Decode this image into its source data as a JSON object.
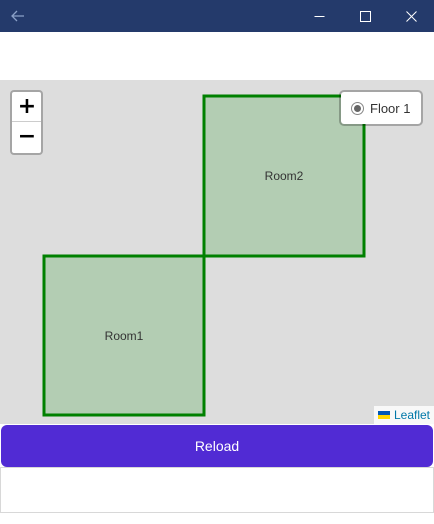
{
  "titlebar": {
    "back_icon": "arrow-left-icon",
    "minimize_icon": "minimize-icon",
    "maximize_icon": "maximize-icon",
    "close_icon": "close-icon",
    "background": "#243a6b"
  },
  "map": {
    "background": "#dddddd",
    "zoom_in_label": "+",
    "zoom_out_label": "−",
    "layer_control": {
      "selected": "Floor 1",
      "options": [
        "Floor 1"
      ]
    },
    "attribution": "Leaflet",
    "rooms": [
      {
        "name": "Room1"
      },
      {
        "name": "Room2"
      }
    ],
    "room_style": {
      "stroke": "#008000",
      "fill": "#b3cdb3"
    }
  },
  "reload_button": {
    "label": "Reload",
    "color": "#512bd4"
  }
}
